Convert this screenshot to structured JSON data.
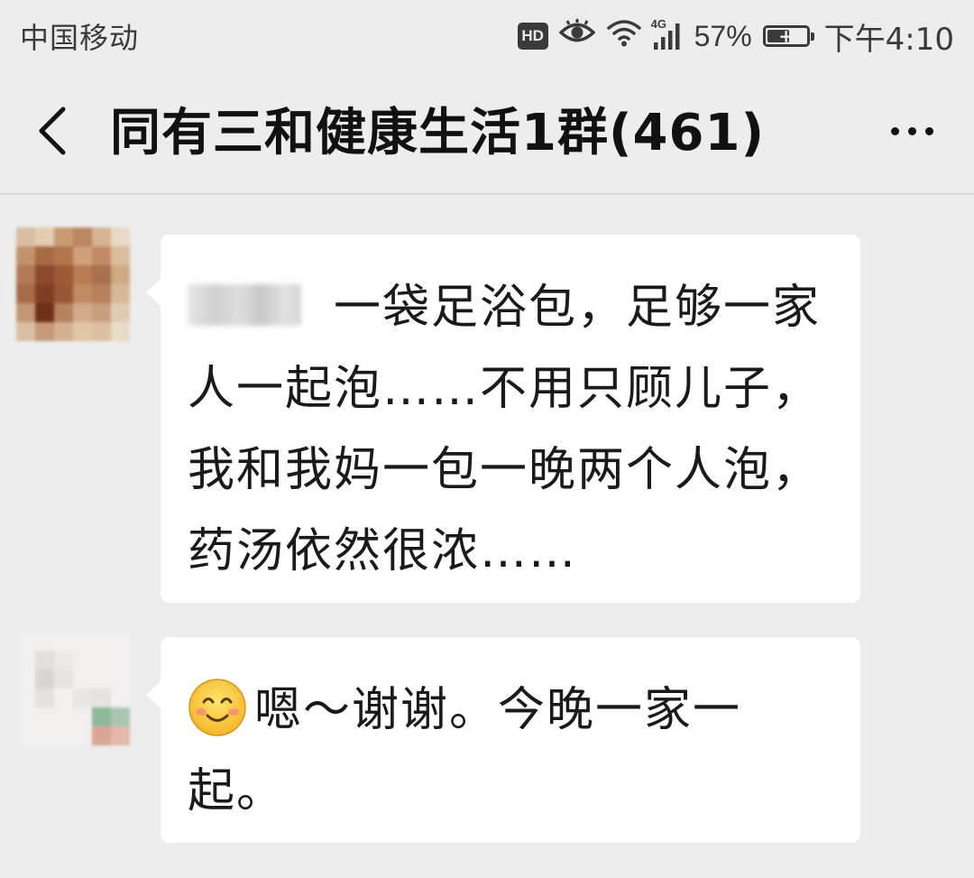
{
  "status_bar": {
    "carrier": "中国移动",
    "hd_label": "HD",
    "network_type": "4G",
    "battery_percent": "57%",
    "battery_level": 0.57,
    "time": "下午4:10"
  },
  "nav": {
    "back_icon": "chevron-left-icon",
    "title": "同有三和健康生活1群(461)",
    "more_icon": "ellipsis-icon"
  },
  "messages": [
    {
      "sender": "",
      "text": "一袋足浴包，足够一家人一起泡……不用只顾儿子，我和我妈一包一晚两个人泡，药汤依然很浓……"
    },
    {
      "emoji": "smiling-face-icon",
      "text": "嗯～谢谢。今晚一家一起。"
    }
  ],
  "colors": {
    "background": "#ededed",
    "bubble": "#ffffff",
    "status_text": "#3a3a3a",
    "title_text": "#111111"
  }
}
